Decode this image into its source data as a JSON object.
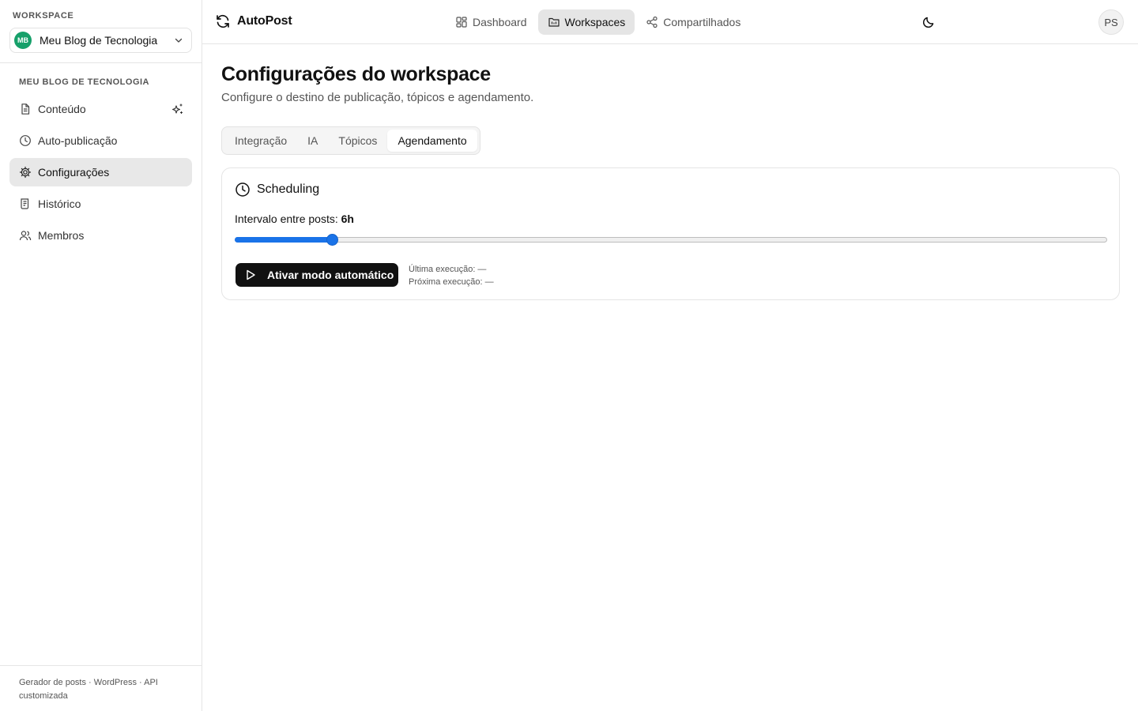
{
  "sidebar": {
    "workspace_label": "WORKSPACE",
    "workspace": {
      "initials": "MB",
      "name": "Meu Blog de Tecnologia",
      "avatar_color": "#16a06a"
    },
    "section_label": "MEU BLOG DE TECNOLOGIA",
    "items": [
      {
        "label": "Conteúdo",
        "icon": "file-text-icon"
      },
      {
        "label": "Auto-publicação",
        "icon": "clock-icon"
      },
      {
        "label": "Configurações",
        "icon": "gear-icon",
        "active": true
      },
      {
        "label": "Histórico",
        "icon": "history-scroll-icon"
      },
      {
        "label": "Membros",
        "icon": "users-icon"
      }
    ],
    "footer": "Gerador de posts · WordPress · API customizada"
  },
  "topbar": {
    "brand": "AutoPost",
    "nav": [
      {
        "label": "Dashboard",
        "icon": "dashboard-grid-icon"
      },
      {
        "label": "Workspaces",
        "icon": "folder-icon",
        "active": true
      },
      {
        "label": "Compartilhados",
        "icon": "share-icon"
      }
    ],
    "theme_icon": "moon-icon",
    "user_initials": "PS"
  },
  "main": {
    "title": "Configurações do workspace",
    "subtitle": "Configure o destino de publicação, tópicos e agendamento.",
    "tabs": [
      "Integração",
      "IA",
      "Tópicos",
      "Agendamento"
    ],
    "active_tab": "Agendamento",
    "scheduling": {
      "title": "Scheduling",
      "interval_label": "Intervalo entre posts:",
      "interval_value": "6h",
      "slider": {
        "min": 1,
        "max": 48,
        "value": 6
      },
      "button_label": "Ativar modo automático",
      "last_run": "Última execução: —",
      "next_run": "Próxima execução: —"
    }
  },
  "colors": {
    "accent": "#1a73e8",
    "button_bg": "#111111",
    "active_bg": "#e8e8e8"
  }
}
